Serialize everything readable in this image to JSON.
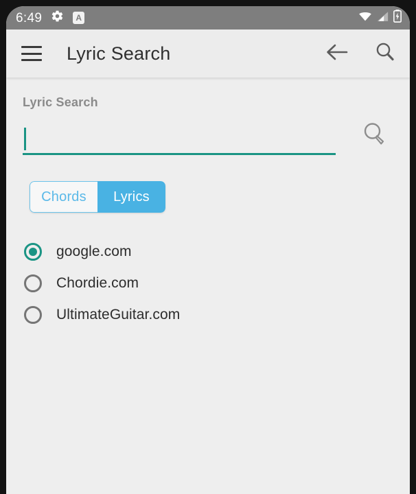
{
  "status_bar": {
    "time": "6:49",
    "icons_left": [
      "gear-icon",
      "font-size-a-badge-icon"
    ],
    "a_badge_label": "A",
    "icons_right": [
      "wifi-icon",
      "cell-signal-icon",
      "battery-charging-icon"
    ],
    "background_color": "#7e7e7e",
    "foreground_color": "#ffffff"
  },
  "app_bar": {
    "menu_icon": "hamburger-menu-icon",
    "title": "Lyric Search",
    "back_icon": "arrow-left-icon",
    "search_icon": "search-icon",
    "background_color": "#ececec",
    "title_color": "#2f2f2f"
  },
  "search_field": {
    "label": "Lyric Search",
    "value": "",
    "placeholder": "",
    "underline_color": "#1a9484",
    "caret_visible": true,
    "submit_icon": "magnifier-search-icon"
  },
  "segmented_control": {
    "options": [
      {
        "label": "Chords",
        "selected": false
      },
      {
        "label": "Lyrics",
        "selected": true
      }
    ],
    "selected_color": "#49b2e3",
    "unselected_text_color": "#5bb9e8"
  },
  "source_options": {
    "selected_index": 0,
    "accent_color": "#1a9484",
    "items": [
      {
        "label": "google.com",
        "selected": true
      },
      {
        "label": "Chordie.com",
        "selected": false
      },
      {
        "label": "UltimateGuitar.com",
        "selected": false
      }
    ]
  }
}
